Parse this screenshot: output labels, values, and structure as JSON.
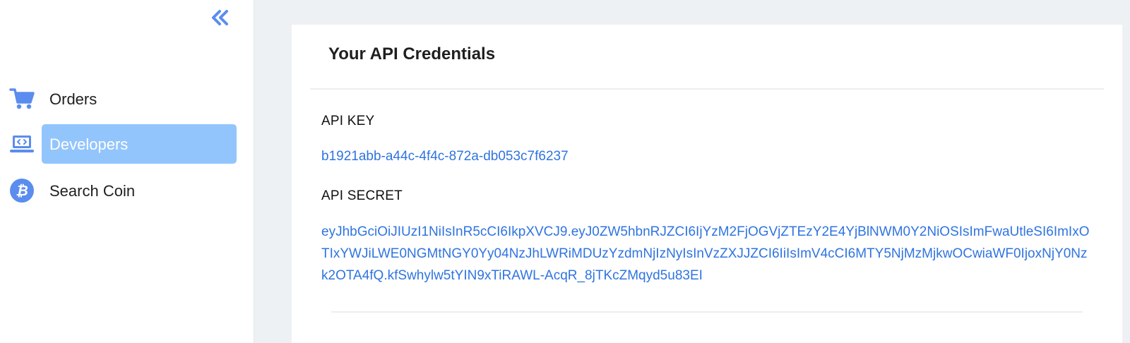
{
  "sidebar": {
    "collapse_icon": "double-chevron-left-icon",
    "items": [
      {
        "label": "Orders",
        "icon": "cart-icon",
        "active": false
      },
      {
        "label": "Developers",
        "icon": "laptop-code-icon",
        "active": true
      },
      {
        "label": "Search Coin",
        "icon": "bitcoin-icon",
        "active": false
      }
    ]
  },
  "card": {
    "title": "Your API Credentials",
    "api_key_label": "API KEY",
    "api_key_value": "b1921abb-a44c-4f4c-872a-db053c7f6237",
    "api_secret_label": "API SECRET",
    "api_secret_value": "eyJhbGciOiJIUzI1NiIsInR5cCI6IkpXVCJ9.eyJ0ZW5hbnRJZCI6IjYzM2FjOGVjZTEzY2E4YjBlNWM0Y2NiOSIsImFwaUtleSI6ImIxOTIxYWJiLWE0NGMtNGY0Yy04NzJhLWRiMDUzYzdmNjIzNyIsInVzZXJJZCI6IiIsImV4cCI6MTY5NjMzMjkwOCwiaWF0IjoxNjY0Nzk2OTA4fQ.kfSwhylw5tYIN9xTiRAWL-AcqR_8jTKcZMqyd5u83EI"
  },
  "colors": {
    "accent": "#93c5fd",
    "link": "#2f74e0",
    "icon": "#5b8def",
    "background": "#eef1f4"
  }
}
